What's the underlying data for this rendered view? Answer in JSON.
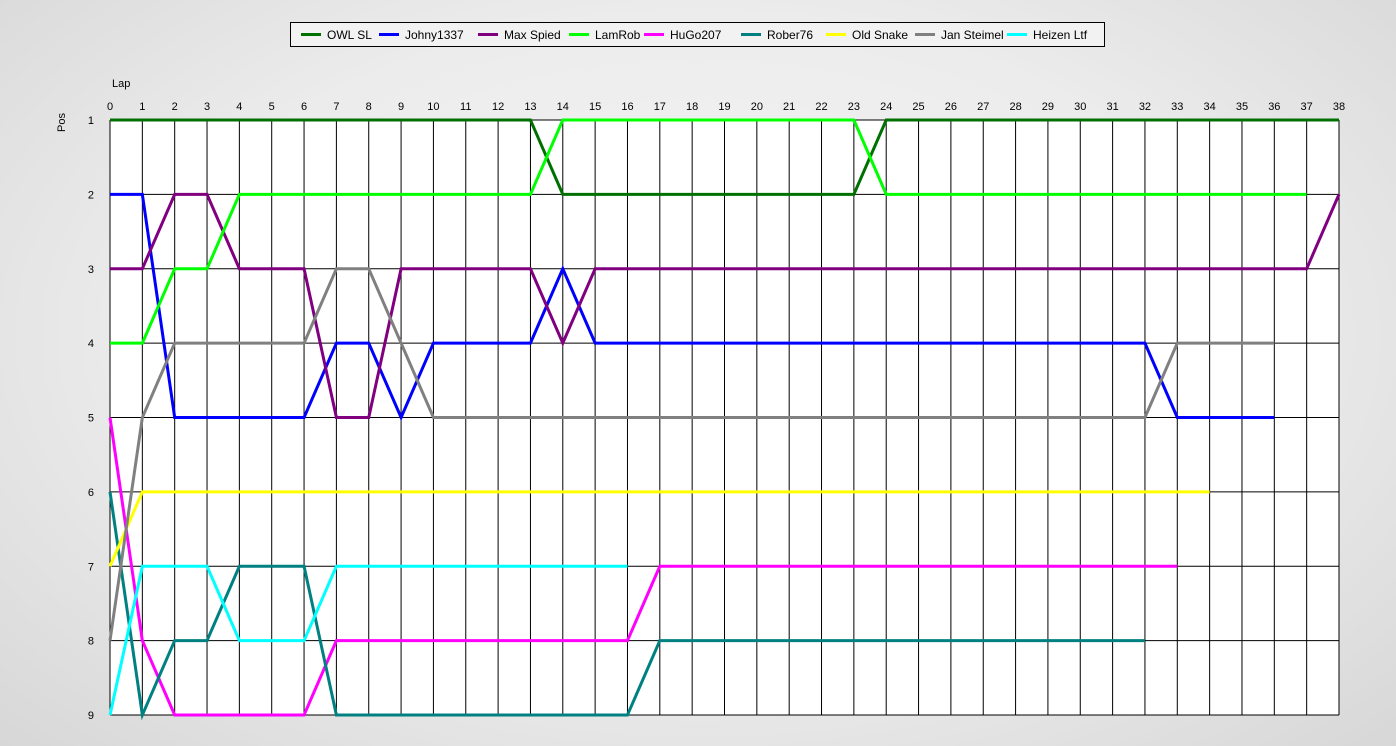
{
  "chart_data": {
    "type": "line",
    "xlabel": "Lap",
    "ylabel": "Pos",
    "xlim": [
      0,
      38
    ],
    "ylim": [
      1,
      9
    ],
    "y_inverted": true,
    "grid": true,
    "legend_position": "top",
    "x_ticks": [
      0,
      1,
      2,
      3,
      4,
      5,
      6,
      7,
      8,
      9,
      10,
      11,
      12,
      13,
      14,
      15,
      16,
      17,
      18,
      19,
      20,
      21,
      22,
      23,
      24,
      25,
      26,
      27,
      28,
      29,
      30,
      31,
      32,
      33,
      34,
      35,
      36,
      37,
      38
    ],
    "y_ticks": [
      1,
      2,
      3,
      4,
      5,
      6,
      7,
      8,
      9
    ],
    "series": [
      {
        "name": "OWL SL",
        "color": "#007000",
        "points": [
          [
            0,
            1
          ],
          [
            1,
            1
          ],
          [
            2,
            1
          ],
          [
            3,
            1
          ],
          [
            4,
            1
          ],
          [
            5,
            1
          ],
          [
            6,
            1
          ],
          [
            7,
            1
          ],
          [
            8,
            1
          ],
          [
            9,
            1
          ],
          [
            10,
            1
          ],
          [
            11,
            1
          ],
          [
            12,
            1
          ],
          [
            13,
            1
          ],
          [
            14,
            2
          ],
          [
            15,
            2
          ],
          [
            16,
            2
          ],
          [
            17,
            2
          ],
          [
            18,
            2
          ],
          [
            19,
            2
          ],
          [
            20,
            2
          ],
          [
            21,
            2
          ],
          [
            22,
            2
          ],
          [
            23,
            2
          ],
          [
            24,
            1
          ],
          [
            25,
            1
          ],
          [
            26,
            1
          ],
          [
            27,
            1
          ],
          [
            28,
            1
          ],
          [
            29,
            1
          ],
          [
            30,
            1
          ],
          [
            31,
            1
          ],
          [
            32,
            1
          ],
          [
            33,
            1
          ],
          [
            34,
            1
          ],
          [
            35,
            1
          ],
          [
            36,
            1
          ],
          [
            37,
            1
          ],
          [
            38,
            1
          ]
        ]
      },
      {
        "name": "Johny1337",
        "color": "#0000ff",
        "points": [
          [
            0,
            2
          ],
          [
            1,
            2
          ],
          [
            2,
            5
          ],
          [
            3,
            5
          ],
          [
            4,
            5
          ],
          [
            5,
            5
          ],
          [
            6,
            5
          ],
          [
            7,
            4
          ],
          [
            8,
            4
          ],
          [
            9,
            5
          ],
          [
            10,
            4
          ],
          [
            11,
            4
          ],
          [
            12,
            4
          ],
          [
            13,
            4
          ],
          [
            14,
            3
          ],
          [
            15,
            4
          ],
          [
            16,
            4
          ],
          [
            17,
            4
          ],
          [
            18,
            4
          ],
          [
            19,
            4
          ],
          [
            20,
            4
          ],
          [
            21,
            4
          ],
          [
            22,
            4
          ],
          [
            23,
            4
          ],
          [
            24,
            4
          ],
          [
            25,
            4
          ],
          [
            26,
            4
          ],
          [
            27,
            4
          ],
          [
            28,
            4
          ],
          [
            29,
            4
          ],
          [
            30,
            4
          ],
          [
            31,
            4
          ],
          [
            32,
            4
          ],
          [
            33,
            5
          ],
          [
            34,
            5
          ],
          [
            35,
            5
          ],
          [
            36,
            5
          ]
        ]
      },
      {
        "name": "Max Spied",
        "color": "#800080",
        "points": [
          [
            0,
            3
          ],
          [
            1,
            3
          ],
          [
            2,
            2
          ],
          [
            3,
            2
          ],
          [
            4,
            3
          ],
          [
            5,
            3
          ],
          [
            6,
            3
          ],
          [
            7,
            5
          ],
          [
            8,
            5
          ],
          [
            9,
            3
          ],
          [
            10,
            3
          ],
          [
            11,
            3
          ],
          [
            12,
            3
          ],
          [
            13,
            3
          ],
          [
            14,
            4
          ],
          [
            15,
            3
          ],
          [
            16,
            3
          ],
          [
            17,
            3
          ],
          [
            18,
            3
          ],
          [
            19,
            3
          ],
          [
            20,
            3
          ],
          [
            21,
            3
          ],
          [
            22,
            3
          ],
          [
            23,
            3
          ],
          [
            24,
            3
          ],
          [
            25,
            3
          ],
          [
            26,
            3
          ],
          [
            27,
            3
          ],
          [
            28,
            3
          ],
          [
            29,
            3
          ],
          [
            30,
            3
          ],
          [
            31,
            3
          ],
          [
            32,
            3
          ],
          [
            33,
            3
          ],
          [
            34,
            3
          ],
          [
            35,
            3
          ],
          [
            36,
            3
          ],
          [
            37,
            3
          ],
          [
            38,
            2
          ]
        ]
      },
      {
        "name": "LamRob",
        "color": "#00ff00",
        "points": [
          [
            0,
            4
          ],
          [
            1,
            4
          ],
          [
            2,
            3
          ],
          [
            3,
            3
          ],
          [
            4,
            2
          ],
          [
            5,
            2
          ],
          [
            6,
            2
          ],
          [
            7,
            2
          ],
          [
            8,
            2
          ],
          [
            9,
            2
          ],
          [
            10,
            2
          ],
          [
            11,
            2
          ],
          [
            12,
            2
          ],
          [
            13,
            2
          ],
          [
            14,
            1
          ],
          [
            15,
            1
          ],
          [
            16,
            1
          ],
          [
            17,
            1
          ],
          [
            18,
            1
          ],
          [
            19,
            1
          ],
          [
            20,
            1
          ],
          [
            21,
            1
          ],
          [
            22,
            1
          ],
          [
            23,
            1
          ],
          [
            24,
            2
          ],
          [
            25,
            2
          ],
          [
            26,
            2
          ],
          [
            27,
            2
          ],
          [
            28,
            2
          ],
          [
            29,
            2
          ],
          [
            30,
            2
          ],
          [
            31,
            2
          ],
          [
            32,
            2
          ],
          [
            33,
            2
          ],
          [
            34,
            2
          ],
          [
            35,
            2
          ],
          [
            36,
            2
          ],
          [
            37,
            2
          ]
        ]
      },
      {
        "name": "HuGo207",
        "color": "#ff00ff",
        "points": [
          [
            0,
            5
          ],
          [
            1,
            8
          ],
          [
            2,
            9
          ],
          [
            3,
            9
          ],
          [
            4,
            9
          ],
          [
            5,
            9
          ],
          [
            6,
            9
          ],
          [
            7,
            8
          ],
          [
            8,
            8
          ],
          [
            9,
            8
          ],
          [
            10,
            8
          ],
          [
            11,
            8
          ],
          [
            12,
            8
          ],
          [
            13,
            8
          ],
          [
            14,
            8
          ],
          [
            15,
            8
          ],
          [
            16,
            8
          ],
          [
            17,
            7
          ],
          [
            18,
            7
          ],
          [
            19,
            7
          ],
          [
            20,
            7
          ],
          [
            21,
            7
          ],
          [
            22,
            7
          ],
          [
            23,
            7
          ],
          [
            24,
            7
          ],
          [
            25,
            7
          ],
          [
            26,
            7
          ],
          [
            27,
            7
          ],
          [
            28,
            7
          ],
          [
            29,
            7
          ],
          [
            30,
            7
          ],
          [
            31,
            7
          ],
          [
            32,
            7
          ],
          [
            33,
            7
          ]
        ]
      },
      {
        "name": "Rober76",
        "color": "#008080",
        "points": [
          [
            0,
            6
          ],
          [
            1,
            9
          ],
          [
            2,
            8
          ],
          [
            3,
            8
          ],
          [
            4,
            7
          ],
          [
            5,
            7
          ],
          [
            6,
            7
          ],
          [
            7,
            9
          ],
          [
            8,
            9
          ],
          [
            9,
            9
          ],
          [
            10,
            9
          ],
          [
            11,
            9
          ],
          [
            12,
            9
          ],
          [
            13,
            9
          ],
          [
            14,
            9
          ],
          [
            15,
            9
          ],
          [
            16,
            9
          ],
          [
            17,
            8
          ],
          [
            18,
            8
          ],
          [
            19,
            8
          ],
          [
            20,
            8
          ],
          [
            21,
            8
          ],
          [
            22,
            8
          ],
          [
            23,
            8
          ],
          [
            24,
            8
          ],
          [
            25,
            8
          ],
          [
            26,
            8
          ],
          [
            27,
            8
          ],
          [
            28,
            8
          ],
          [
            29,
            8
          ],
          [
            30,
            8
          ],
          [
            31,
            8
          ],
          [
            32,
            8
          ]
        ]
      },
      {
        "name": "Old Snake",
        "color": "#ffff00",
        "points": [
          [
            0,
            7
          ],
          [
            1,
            6
          ],
          [
            2,
            6
          ],
          [
            3,
            6
          ],
          [
            4,
            6
          ],
          [
            5,
            6
          ],
          [
            6,
            6
          ],
          [
            7,
            6
          ],
          [
            8,
            6
          ],
          [
            9,
            6
          ],
          [
            10,
            6
          ],
          [
            11,
            6
          ],
          [
            12,
            6
          ],
          [
            13,
            6
          ],
          [
            14,
            6
          ],
          [
            15,
            6
          ],
          [
            16,
            6
          ],
          [
            17,
            6
          ],
          [
            18,
            6
          ],
          [
            19,
            6
          ],
          [
            20,
            6
          ],
          [
            21,
            6
          ],
          [
            22,
            6
          ],
          [
            23,
            6
          ],
          [
            24,
            6
          ],
          [
            25,
            6
          ],
          [
            26,
            6
          ],
          [
            27,
            6
          ],
          [
            28,
            6
          ],
          [
            29,
            6
          ],
          [
            30,
            6
          ],
          [
            31,
            6
          ],
          [
            32,
            6
          ],
          [
            33,
            6
          ],
          [
            34,
            6
          ]
        ]
      },
      {
        "name": "Jan Steimel",
        "color": "#808080",
        "points": [
          [
            0,
            8
          ],
          [
            1,
            5
          ],
          [
            2,
            4
          ],
          [
            3,
            4
          ],
          [
            4,
            4
          ],
          [
            5,
            4
          ],
          [
            6,
            4
          ],
          [
            7,
            3
          ],
          [
            8,
            3
          ],
          [
            9,
            4
          ],
          [
            10,
            5
          ],
          [
            11,
            5
          ],
          [
            12,
            5
          ],
          [
            13,
            5
          ],
          [
            14,
            5
          ],
          [
            15,
            5
          ],
          [
            16,
            5
          ],
          [
            17,
            5
          ],
          [
            18,
            5
          ],
          [
            19,
            5
          ],
          [
            20,
            5
          ],
          [
            21,
            5
          ],
          [
            22,
            5
          ],
          [
            23,
            5
          ],
          [
            24,
            5
          ],
          [
            25,
            5
          ],
          [
            26,
            5
          ],
          [
            27,
            5
          ],
          [
            28,
            5
          ],
          [
            29,
            5
          ],
          [
            30,
            5
          ],
          [
            31,
            5
          ],
          [
            32,
            5
          ],
          [
            33,
            4
          ],
          [
            34,
            4
          ],
          [
            35,
            4
          ],
          [
            36,
            4
          ]
        ]
      },
      {
        "name": "Heizen Ltf",
        "color": "#00ffff",
        "points": [
          [
            0,
            9
          ],
          [
            1,
            7
          ],
          [
            2,
            7
          ],
          [
            3,
            7
          ],
          [
            4,
            8
          ],
          [
            5,
            8
          ],
          [
            6,
            8
          ],
          [
            7,
            7
          ],
          [
            8,
            7
          ],
          [
            9,
            7
          ],
          [
            10,
            7
          ],
          [
            11,
            7
          ],
          [
            12,
            7
          ],
          [
            13,
            7
          ],
          [
            14,
            7
          ],
          [
            15,
            7
          ],
          [
            16,
            7
          ]
        ]
      }
    ]
  }
}
